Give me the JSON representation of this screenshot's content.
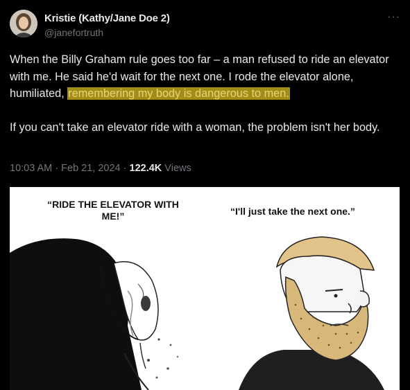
{
  "author": {
    "display_name": "Kristie (Kathy/Jane Doe 2)",
    "handle": "@janefortruth"
  },
  "menu": {
    "more_label": "···"
  },
  "tweet": {
    "text_line1": "When the Billy Graham rule goes too far – a man refused to ride an elevator with me. He said he'd wait for the next one. I rode the elevator alone, humiliated, ",
    "text_highlight": "remembering my body is dangerous to men.",
    "text_para2": "If you can't take an elevator ride with a woman, the problem isn't her body.",
    "time": "10:03 AM",
    "sep1": " · ",
    "date": "Feb 21, 2024",
    "sep2": " · ",
    "views_count": "122.4K",
    "views_label": " Views"
  },
  "meme": {
    "caption_left": "“RIDE THE ELEVATOR WITH ME!”",
    "caption_right": "“I'll just take the next one.”"
  },
  "colors": {
    "background": "#000000",
    "text": "#e7e9ea",
    "muted": "#71767b",
    "highlight_bg": "#a38d16",
    "highlight_text": "#e7d47a"
  }
}
